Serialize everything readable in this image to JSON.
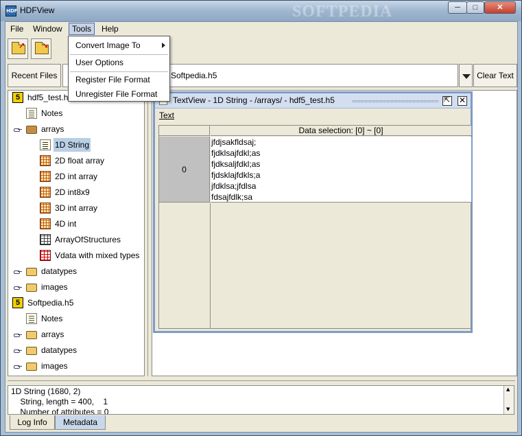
{
  "window": {
    "title": "HDFView",
    "watermark": "SOFTPEDIA",
    "app_icon": "hdf-icon",
    "min": "─",
    "max": "□",
    "close": "✕"
  },
  "menubar": {
    "file": "File",
    "window": "Window",
    "tools": "Tools",
    "help": "Help"
  },
  "toolbar": {
    "open_icon": "open-folder-icon",
    "close_icon": "close-folder-icon"
  },
  "pathrow": {
    "recent_label": "Recent Files",
    "path_value": "Softpedia.h5",
    "clear_label": "Clear Text"
  },
  "tools_menu": {
    "items": [
      "Convert Image To",
      "User Options",
      "Register File Format",
      "Unregister File Format"
    ]
  },
  "tree": {
    "nodes": [
      {
        "label": "hdf5_test.h5",
        "icon": "h5-file-icon"
      },
      {
        "label": "Notes",
        "icon": "notes-icon"
      },
      {
        "label": "arrays",
        "icon": "folder-open-icon"
      },
      {
        "label": "1D String",
        "icon": "text-dataset-icon",
        "selected": true
      },
      {
        "label": "2D float array",
        "icon": "grid-dataset-icon"
      },
      {
        "label": "2D int array",
        "icon": "grid-dataset-icon"
      },
      {
        "label": "2D int8x9",
        "icon": "grid-dataset-icon"
      },
      {
        "label": "3D int array",
        "icon": "grid-dataset-icon"
      },
      {
        "label": "4D int",
        "icon": "grid-dataset-icon"
      },
      {
        "label": "ArrayOfStructures",
        "icon": "table-dataset-icon"
      },
      {
        "label": "Vdata with mixed types",
        "icon": "vdata-icon"
      },
      {
        "label": "datatypes",
        "icon": "folder-icon"
      },
      {
        "label": "images",
        "icon": "folder-icon"
      },
      {
        "label": "Softpedia.h5",
        "icon": "h5-file-icon"
      },
      {
        "label": "Notes",
        "icon": "notes-icon"
      },
      {
        "label": "arrays",
        "icon": "folder-icon"
      },
      {
        "label": "datatypes",
        "icon": "folder-icon"
      },
      {
        "label": "images",
        "icon": "folder-icon"
      }
    ]
  },
  "textview": {
    "title": "TextView  -  1D String  -  /arrays/  -  hdf5_test.h5",
    "menu": "Text",
    "column_header": "Data selection:   [0] ~ [0]",
    "row_index": "0",
    "lines": [
      "jfdjsakfldsaj;",
      "fjdklsajfdkl;as",
      "fjdksaljfdkl;as",
      "fjdsklajfdkls;a",
      "jfdklsa;jfdlsa",
      "fdsajfdlk;sa"
    ]
  },
  "info": {
    "lines": [
      "1D String (1680, 2)",
      "    String, length = 400,    1",
      "    Number of attributes = 0"
    ]
  },
  "tabs": {
    "log": "Log Info",
    "metadata": "Metadata"
  },
  "colors": {
    "selection": "#b8cfe5",
    "frame_border": "#7d9bc7",
    "h5_icon": "#f2d000"
  }
}
